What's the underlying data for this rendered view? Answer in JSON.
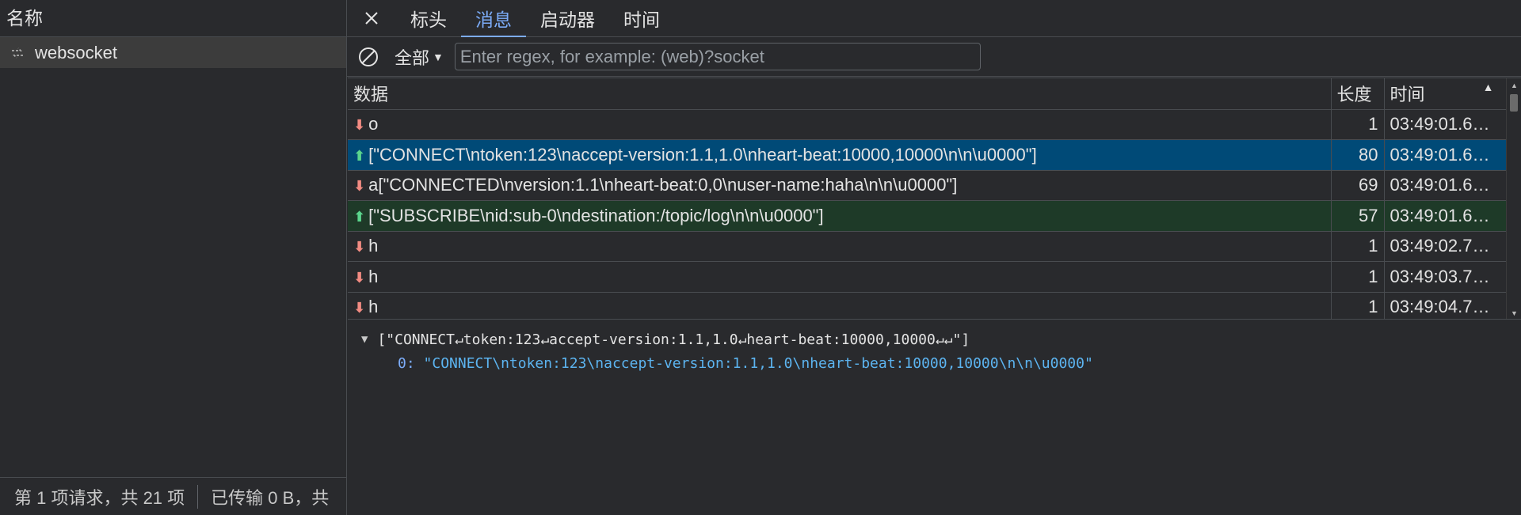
{
  "requests_pane": {
    "header": "名称",
    "items": [
      {
        "name": "websocket",
        "icon": "websocket-icon"
      }
    ],
    "footer_requests": "第 1 项请求，共 21 项",
    "footer_transferred": "已传输 0 B，共"
  },
  "tabs": [
    "标头",
    "消息",
    "启动器",
    "时间"
  ],
  "active_tab": "消息",
  "filter": {
    "type_label": "全部",
    "placeholder": "Enter regex, for example: (web)?socket"
  },
  "table": {
    "headers": {
      "data": "数据",
      "length": "长度",
      "time": "时间"
    },
    "rows": [
      {
        "dir": "down",
        "data": "o",
        "length": "1",
        "time": "03:49:01.6…"
      },
      {
        "dir": "up",
        "data": "[\"CONNECT\\ntoken:123\\naccept-version:1.1,1.0\\nheart-beat:10000,10000\\n\\n\\u0000\"]",
        "length": "80",
        "time": "03:49:01.6…"
      },
      {
        "dir": "down",
        "data": "a[\"CONNECTED\\nversion:1.1\\nheart-beat:0,0\\nuser-name:haha\\n\\n\\u0000\"]",
        "length": "69",
        "time": "03:49:01.6…"
      },
      {
        "dir": "up",
        "data": "[\"SUBSCRIBE\\nid:sub-0\\ndestination:/topic/log\\n\\n\\u0000\"]",
        "length": "57",
        "time": "03:49:01.6…"
      },
      {
        "dir": "down",
        "data": "h",
        "length": "1",
        "time": "03:49:02.7…"
      },
      {
        "dir": "down",
        "data": "h",
        "length": "1",
        "time": "03:49:03.7…"
      },
      {
        "dir": "down",
        "data": "h",
        "length": "1",
        "time": "03:49:04.7…"
      }
    ]
  },
  "detail": {
    "summary": "[\"CONNECT↵token:123↵accept-version:1.1,1.0↵heart-beat:10000,10000↵↵\"]",
    "key": "0",
    "value": "\"CONNECT\\ntoken:123\\naccept-version:1.1,1.0\\nheart-beat:10000,10000\\n\\n\\u0000\""
  }
}
